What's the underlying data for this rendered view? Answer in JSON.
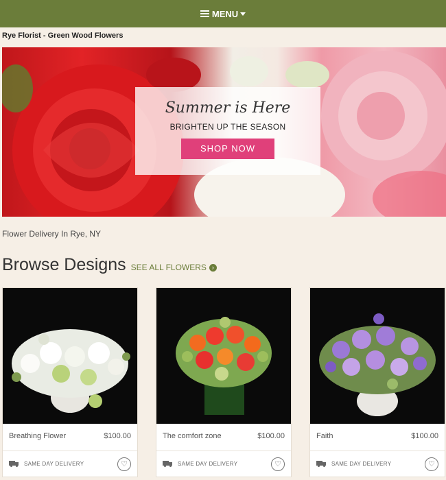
{
  "header": {
    "menu_label": "MENU"
  },
  "site": {
    "title": "Rye Florist - Green Wood Flowers"
  },
  "hero": {
    "headline": "Summer is Here",
    "subheadline": "BRIGHTEN UP THE SEASON",
    "cta_label": "SHOP NOW"
  },
  "intro": {
    "delivery_text": "Flower Delivery In Rye, NY"
  },
  "browse": {
    "title": "Browse Designs",
    "see_all_label": "SEE ALL FLOWERS"
  },
  "products": [
    {
      "name": "Breathing Flower",
      "price": "$100.00",
      "delivery": "SAME DAY DELIVERY"
    },
    {
      "name": "The comfort zone",
      "price": "$100.00",
      "delivery": "SAME DAY DELIVERY"
    },
    {
      "name": "Faith",
      "price": "$100.00",
      "delivery": "SAME DAY DELIVERY"
    }
  ],
  "colors": {
    "brand_green": "#6b7d3a",
    "cta_pink": "#e0407a",
    "background": "#f6efe6"
  }
}
